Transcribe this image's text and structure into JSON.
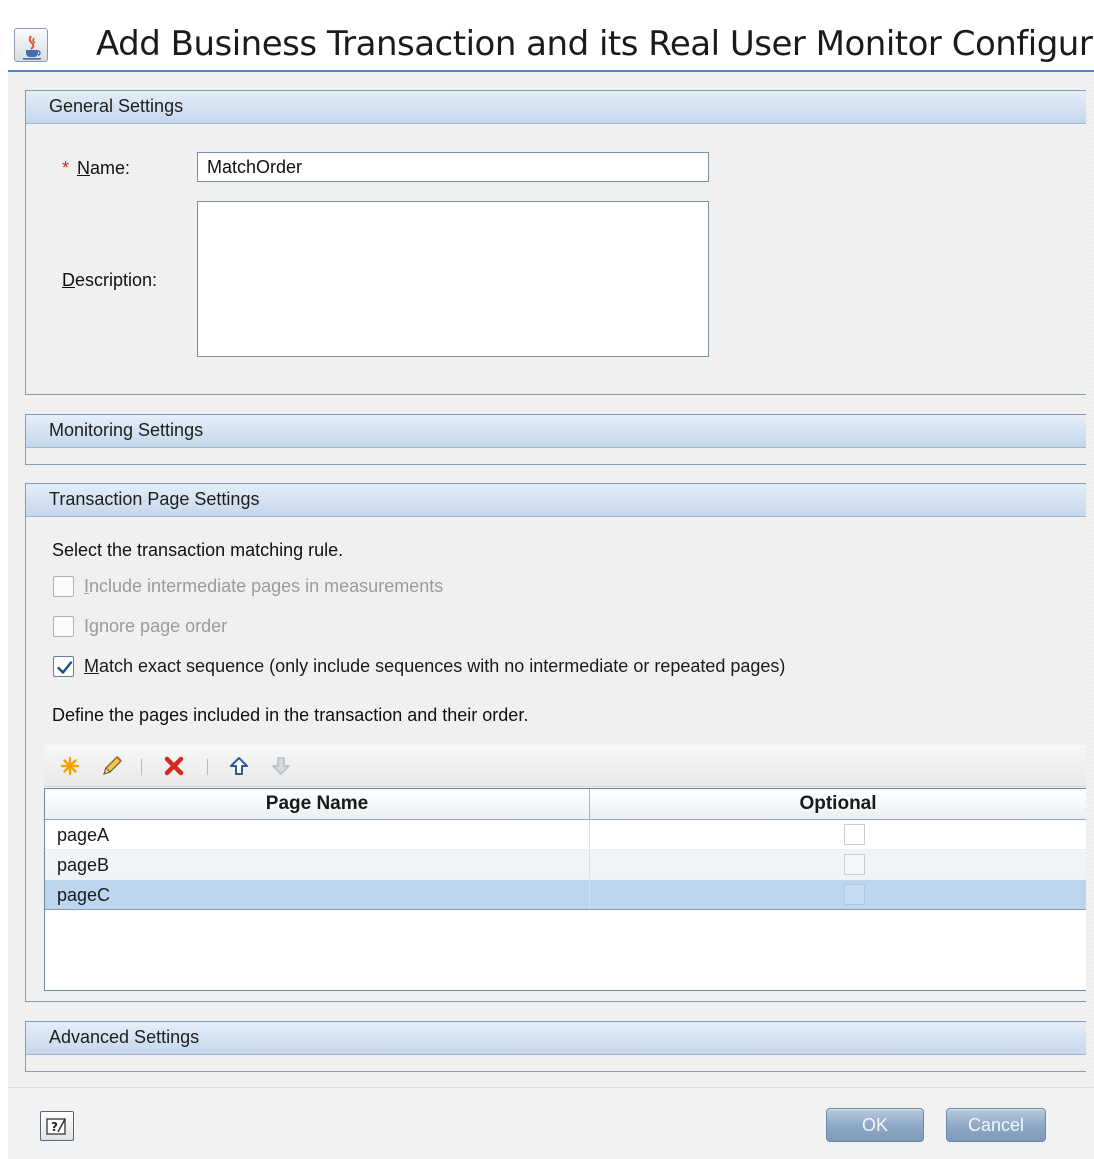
{
  "window": {
    "title": "Add Business Transaction and its Real User Monitor Configura",
    "icon": "java-cup-icon"
  },
  "general": {
    "header": "General Settings",
    "required_mark": "*",
    "name_label_prefix": "",
    "name_label_mnemonic": "N",
    "name_label_rest": "ame:",
    "name_value": "MatchOrder",
    "description_label_mnemonic": "D",
    "description_label_rest": "escription:",
    "description_value": ""
  },
  "monitoring": {
    "header": "Monitoring Settings"
  },
  "transaction": {
    "header": "Transaction Page Settings",
    "rule_prompt": "Select the transaction matching rule.",
    "options": [
      {
        "mnemonic": "I",
        "rest": "nclude intermediate pages in measurements",
        "checked": false,
        "enabled": false
      },
      {
        "mnemonic": "g",
        "prefix": "I",
        "rest": "nore page order",
        "checked": false,
        "enabled": false
      },
      {
        "mnemonic": "M",
        "rest": "atch exact sequence (only include sequences with no intermediate or repeated pages)",
        "checked": true,
        "enabled": true
      }
    ],
    "define_prompt": "Define the pages included in the transaction and their order.",
    "toolbar": [
      "new-icon",
      "edit-icon",
      "delete-icon",
      "move-up-icon",
      "move-down-icon"
    ],
    "columns": [
      "Page Name",
      "Optional"
    ],
    "rows": [
      {
        "page": "pageA",
        "optional": false,
        "selected": false
      },
      {
        "page": "pageB",
        "optional": false,
        "selected": false
      },
      {
        "page": "pageC",
        "optional": false,
        "selected": true
      }
    ]
  },
  "advanced": {
    "header": "Advanced Settings"
  },
  "footer": {
    "help_icon": "help-icon",
    "ok_label": "OK",
    "cancel_label": "Cancel"
  },
  "colors": {
    "header_gradient_top": "#e6eef8",
    "header_gradient_bottom": "#c6d7ec",
    "selected_row": "#bcd6ef",
    "required": "#d4262c",
    "button": "#8fa9c6"
  }
}
